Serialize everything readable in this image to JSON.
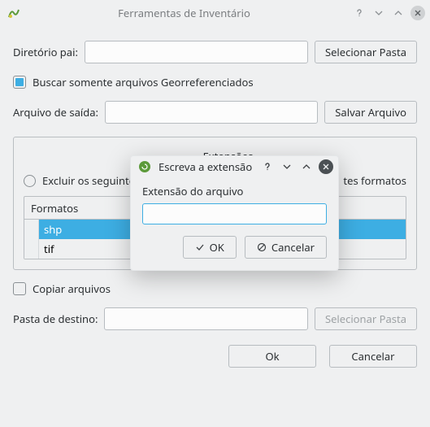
{
  "window": {
    "title": "Ferramentas de Inventário"
  },
  "form": {
    "parent_dir_label": "Diretório pai:",
    "parent_dir_value": "",
    "select_folder_label": "Selecionar Pasta",
    "georef_label": "Buscar somente arquivos Georreferenciados",
    "output_file_label": "Arquivo de saída:",
    "output_file_value": "",
    "save_file_label": "Salvar Arquivo"
  },
  "formats_group": {
    "head_extensions_label": "Extensões",
    "radio_exclude_label": "Excluir os seguintes formatos",
    "radio_include_right": "tes formatos",
    "table_header": "Formatos",
    "rows": [
      "shp",
      "tif"
    ]
  },
  "copy": {
    "copy_label": "Copiar arquivos",
    "dest_label": "Pasta de destino:",
    "dest_value": "",
    "select_folder_label": "Selecionar Pasta"
  },
  "footer": {
    "ok_label": "Ok",
    "cancel_label": "Cancelar"
  },
  "modal": {
    "title": "Escreva a extensão",
    "field_label": "Extensão do arquivo",
    "field_value": "",
    "ok_label": "OK",
    "cancel_label": "Cancelar"
  }
}
